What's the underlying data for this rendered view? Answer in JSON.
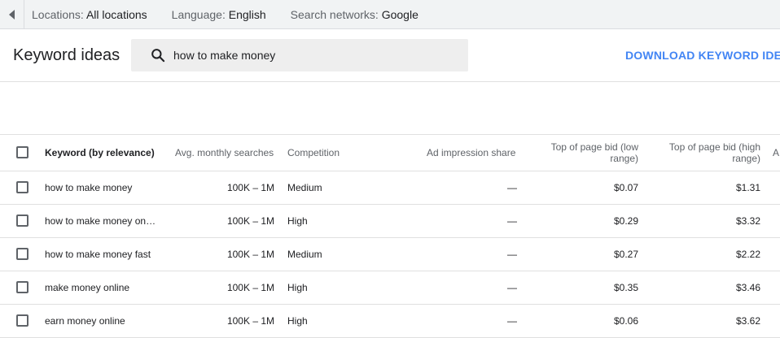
{
  "filters": {
    "locations_label": "Locations:",
    "locations_value": "All locations",
    "language_label": "Language:",
    "language_value": "English",
    "networks_label": "Search networks:",
    "networks_value": "Google"
  },
  "header": {
    "title": "Keyword ideas",
    "search_value": "how to make money",
    "download_label": "DOWNLOAD KEYWORD IDEAS"
  },
  "table": {
    "headers": {
      "keyword": "Keyword (by relevance)",
      "avg": "Avg. monthly searches",
      "competition": "Competition",
      "ad_impression": "Ad impression share",
      "bid_low": "Top of page bid (low range)",
      "bid_high": "Top of page bid (high range)",
      "more": "A"
    },
    "rows": [
      {
        "keyword": "how to make money",
        "avg": "100K – 1M",
        "competition": "Medium",
        "ad_impression": "—",
        "bid_low": "$0.07",
        "bid_high": "$1.31"
      },
      {
        "keyword": "how to make money on…",
        "avg": "100K – 1M",
        "competition": "High",
        "ad_impression": "—",
        "bid_low": "$0.29",
        "bid_high": "$3.32"
      },
      {
        "keyword": "how to make money fast",
        "avg": "100K – 1M",
        "competition": "Medium",
        "ad_impression": "—",
        "bid_low": "$0.27",
        "bid_high": "$2.22"
      },
      {
        "keyword": "make money online",
        "avg": "100K – 1M",
        "competition": "High",
        "ad_impression": "—",
        "bid_low": "$0.35",
        "bid_high": "$3.46"
      },
      {
        "keyword": "earn money online",
        "avg": "100K – 1M",
        "competition": "High",
        "ad_impression": "—",
        "bid_low": "$0.06",
        "bid_high": "$3.62"
      }
    ]
  },
  "icons": {
    "collapse": "triangle-left-icon",
    "search": "search-icon"
  },
  "colors": {
    "link": "#4285f4",
    "topbar_bg": "#f1f3f4",
    "search_bg": "#eeeeee"
  }
}
